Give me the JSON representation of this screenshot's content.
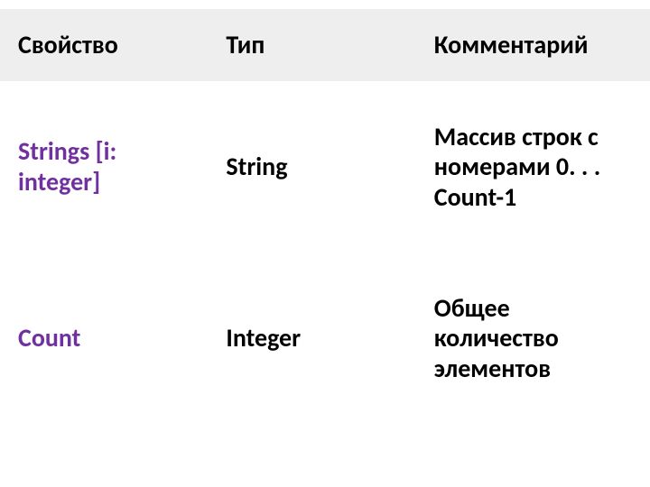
{
  "chart_data": {
    "type": "table",
    "columns": [
      "Свойство",
      "Тип",
      "Комментарий"
    ],
    "rows": [
      [
        "Strings [i: integer]",
        "String",
        "Массив строк с номерами 0. . . Count-1"
      ],
      [
        "Count",
        "Integer",
        "Общее количество элементов"
      ]
    ]
  },
  "headers": {
    "property": "Свойство",
    "type": "Тип",
    "comment": "Комментарий"
  },
  "rows": [
    {
      "property": "Strings [i: integer]",
      "type": "String",
      "comment": "Массив строк с номерами 0. . . Count-1"
    },
    {
      "property": "Count",
      "type": "Integer",
      "comment": "Общее количество элементов"
    }
  ]
}
